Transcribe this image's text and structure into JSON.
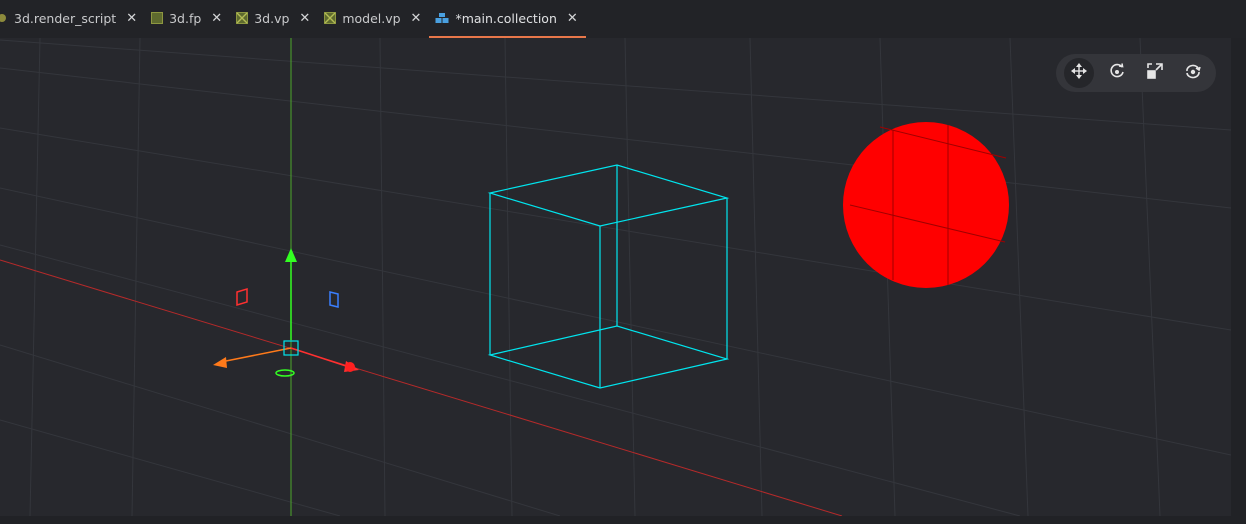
{
  "tabs": [
    {
      "label": "3d.render_script",
      "icon": "script-file-icon",
      "active": false
    },
    {
      "label": "3d.fp",
      "icon": "fragment-program-icon",
      "active": false
    },
    {
      "label": "3d.vp",
      "icon": "vertex-program-icon",
      "active": false
    },
    {
      "label": "model.vp",
      "icon": "vertex-program-icon",
      "active": false
    },
    {
      "label": "*main.collection",
      "icon": "collection-icon",
      "active": true
    }
  ],
  "close_glyph": "✕",
  "toolbar": {
    "tools": [
      {
        "name": "move-tool",
        "active": true
      },
      {
        "name": "rotate-tool",
        "active": false
      },
      {
        "name": "scale-tool",
        "active": false
      },
      {
        "name": "camera-reset-tool",
        "active": false
      }
    ]
  },
  "colors": {
    "accent": "#e8774a",
    "wireframe": "#00e5ee",
    "sphere": "#ff0000",
    "axis_x": "#ff3030",
    "axis_y": "#33ff22",
    "axis_z": "#ff7a1a"
  }
}
